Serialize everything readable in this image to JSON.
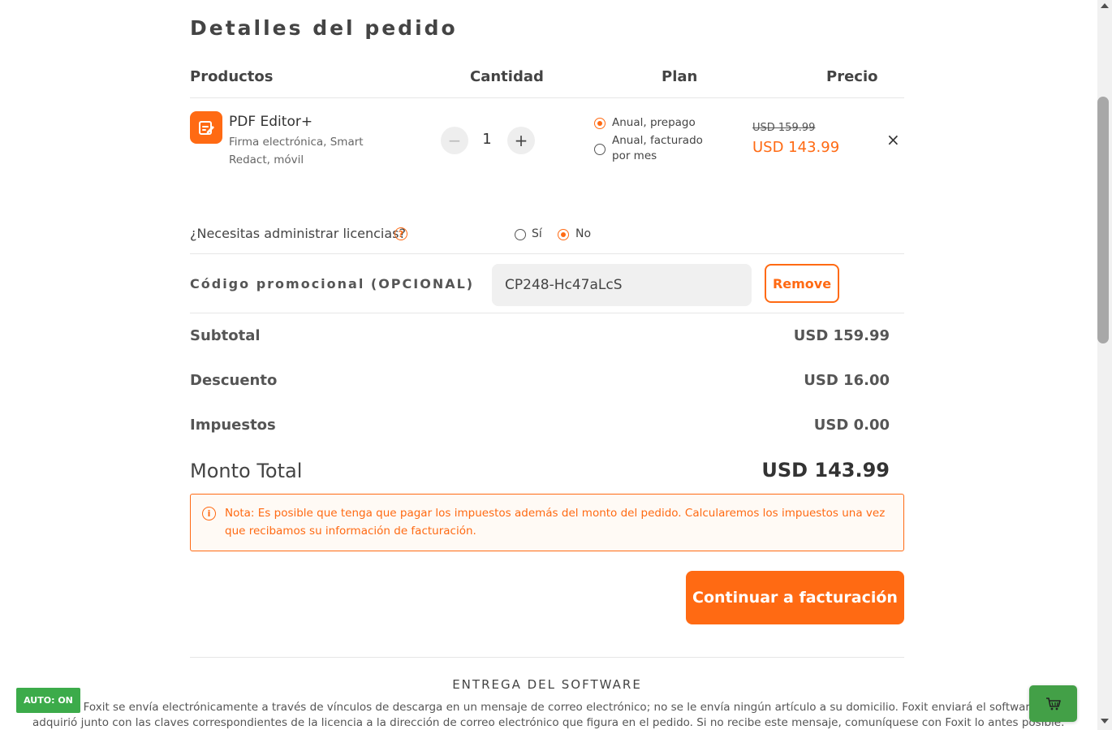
{
  "order": {
    "title": "Detalles del pedido",
    "headers": {
      "products": "Productos",
      "quantity": "Cantidad",
      "plan": "Plan",
      "price": "Precio"
    },
    "item": {
      "name": "PDF Editor+",
      "description": "Firma electrónica, Smart Redact, móvil",
      "quantity": "1",
      "minus": "−",
      "plus": "+",
      "plans": [
        {
          "label": "Anual, prepago",
          "selected": true
        },
        {
          "label": "Anual, facturado por mes",
          "selected": false
        }
      ],
      "price_original": "USD 159.99",
      "price_current": "USD 143.99",
      "remove": "×"
    },
    "licenses": {
      "question": "¿Necesitas administrar licencias?",
      "help": "?",
      "options": [
        {
          "label": "Sí",
          "selected": false
        },
        {
          "label": "No",
          "selected": true
        }
      ]
    },
    "promo": {
      "label": "Código promocional (OPCIONAL)",
      "value": "CP248-Hc47aLcS",
      "remove_label": "Remove"
    },
    "summary": {
      "subtotal_label": "Subtotal",
      "subtotal_value": "USD 159.99",
      "discount_label": "Descuento",
      "discount_value": "USD 16.00",
      "tax_label": "Impuestos",
      "tax_value": "USD 0.00",
      "total_label": "Monto Total",
      "total_value": "USD 143.99"
    },
    "note": {
      "icon": "i",
      "text": "Nota: Es posible que tenga que pagar los impuestos además del monto del pedido. Calcularemos los impuestos una vez que recibamos su información de facturación."
    },
    "continue_label": "Continuar a facturación"
  },
  "delivery": {
    "title": "ENTREGA DEL SOFTWARE",
    "line1": "tware Foxit se envía electrónicamente a través de vínculos de descarga en un mensaje de correo electrónico; no se le envía ningún artículo a su domicilio. Foxit enviará el software q",
    "line2": "adquirió junto con las claves correspondientes de la licencia a la dirección de correo electrónico que figura en el pedido. Si no recibe este mensaje, comuníquese con Foxit lo antes posible."
  },
  "overlay": {
    "auto_badge": "AUTO: ON",
    "cart_icon": "cart-icon"
  },
  "colors": {
    "accent": "#ff6a13",
    "green": "#43a047"
  }
}
